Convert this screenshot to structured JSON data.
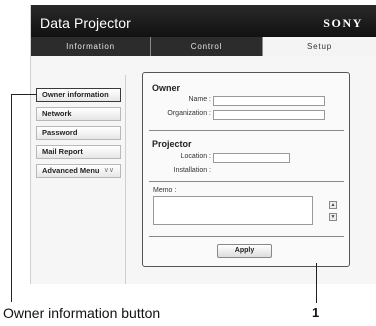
{
  "app": {
    "title": "Data Projector",
    "brand": "SONY"
  },
  "tabs": [
    {
      "label": "Information",
      "active": false
    },
    {
      "label": "Control",
      "active": false
    },
    {
      "label": "Setup",
      "active": true
    }
  ],
  "sidebar": {
    "items": [
      {
        "label": "Owner information",
        "selected": true
      },
      {
        "label": "Network",
        "selected": false
      },
      {
        "label": "Password",
        "selected": false
      },
      {
        "label": "Mail Report",
        "selected": false
      },
      {
        "label": "Advanced Menu",
        "selected": false,
        "icon": "double-chevron-down-icon"
      }
    ]
  },
  "panel": {
    "owner": {
      "title": "Owner",
      "name_label": "Name :",
      "name_value": "",
      "organization_label": "Organization :",
      "organization_value": ""
    },
    "projector": {
      "title": "Projector",
      "location_label": "Location :",
      "location_value": "",
      "installation_label": "Installation :"
    },
    "memo": {
      "label": "Memo :",
      "value": ""
    },
    "apply_label": "Apply"
  },
  "annotations": {
    "owner_button_caption": "Owner information button",
    "panel_number": "1"
  },
  "colors": {
    "header_bg": "#111111",
    "tab_bg": "#2c2c2c",
    "page_bg": "#f6f6f6"
  }
}
